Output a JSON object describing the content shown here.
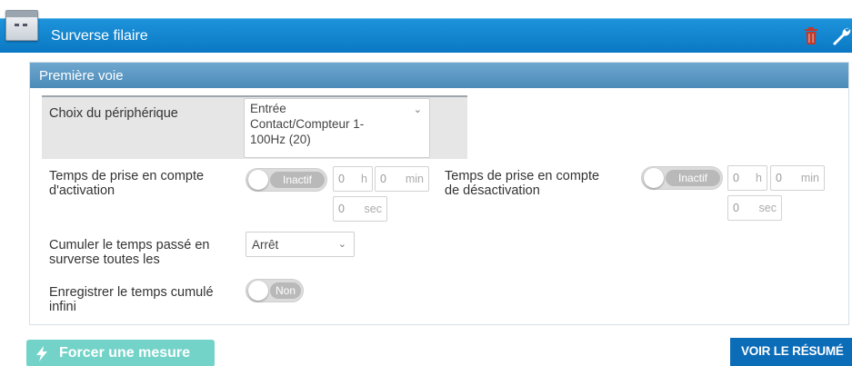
{
  "header": {
    "title": "Surverse filaire",
    "colors": {
      "bar": "#0a78c4",
      "trash": "#c0392b"
    }
  },
  "panel": {
    "title": "Première voie",
    "device": {
      "label": "Choix du périphérique",
      "value_lines": [
        "Entrée",
        "Contact/Compteur 1-",
        "100Hz (20)"
      ]
    },
    "activation": {
      "label_lines": [
        "Temps de prise en compte",
        "d'activation"
      ],
      "toggle_text": "Inactif",
      "hours": "0",
      "hours_unit": "h",
      "minutes": "0",
      "minutes_unit": "min",
      "seconds": "0",
      "seconds_unit": "sec"
    },
    "deactivation": {
      "label_lines": [
        "Temps de prise en compte",
        "de désactivation"
      ],
      "toggle_text": "Inactif",
      "hours": "0",
      "hours_unit": "h",
      "minutes": "0",
      "minutes_unit": "min",
      "seconds": "0",
      "seconds_unit": "sec"
    },
    "cumulate": {
      "label_lines": [
        "Cumuler le temps passé en",
        "surverse toutes les"
      ],
      "value": "Arrêt"
    },
    "record": {
      "label_lines": [
        "Enregistrer le temps cumulé",
        "infini"
      ],
      "toggle_text": "Non"
    }
  },
  "footer": {
    "force_label": "Forcer une mesure",
    "resume_label": "VOIR LE RÉSUMÉ"
  }
}
